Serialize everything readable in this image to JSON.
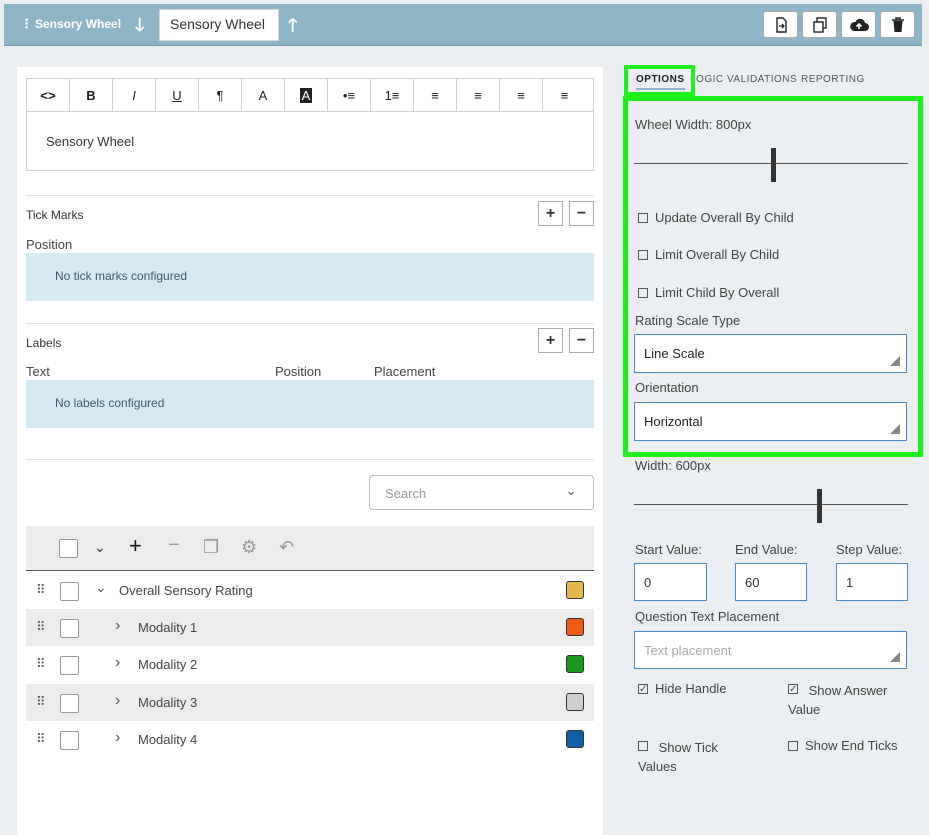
{
  "header": {
    "menu_glyph": "⋮",
    "app_title": "Sensory Wheel",
    "question_title": "Sensory Wheel",
    "down_glyph": "🡓",
    "up_glyph": "🡑"
  },
  "editor": {
    "toolbar": [
      {
        "name": "code-view-button",
        "glyph": "<>"
      },
      {
        "name": "bold-button",
        "glyph": "B"
      },
      {
        "name": "italic-button",
        "glyph": "I"
      },
      {
        "name": "underline-button",
        "glyph": "U"
      },
      {
        "name": "paragraph-button",
        "glyph": "¶"
      },
      {
        "name": "font-color-button",
        "glyph": "A"
      },
      {
        "name": "bg-color-button",
        "glyph": "A"
      },
      {
        "name": "bullet-list-button",
        "glyph": "•≡"
      },
      {
        "name": "numbered-list-button",
        "glyph": "1≡"
      },
      {
        "name": "align-left-button",
        "glyph": "≡"
      },
      {
        "name": "align-center-button",
        "glyph": "≡"
      },
      {
        "name": "align-right-button",
        "glyph": "≡"
      },
      {
        "name": "justify-button",
        "glyph": "≡"
      }
    ],
    "content": "Sensory Wheel"
  },
  "tick_marks": {
    "title": "Tick Marks",
    "position_label": "Position",
    "empty_text": "No tick marks configured",
    "add_glyph": "+",
    "remove_glyph": "−"
  },
  "labels": {
    "title": "Labels",
    "col_text": "Text",
    "col_position": "Position",
    "col_placement": "Placement",
    "empty_text": "No labels configured",
    "add_glyph": "+",
    "remove_glyph": "−"
  },
  "search": {
    "placeholder": "Search",
    "chevron": "⌄"
  },
  "tree": {
    "toolbar": {
      "dropdown": "⌄",
      "add": "+",
      "remove": "−",
      "copy": "❐",
      "settings": "⚙",
      "undo": "↶"
    },
    "rows": [
      {
        "label": "Overall Sensory Rating",
        "expander": "⌄",
        "color": "#e8b84a"
      },
      {
        "label": "Modality 1",
        "expander": "›",
        "color": "#f05a14"
      },
      {
        "label": "Modality 2",
        "expander": "›",
        "color": "#1e9a22"
      },
      {
        "label": "Modality 3",
        "expander": "›",
        "color": "#cfcfcf"
      },
      {
        "label": "Modality 4",
        "expander": "›",
        "color": "#1060a8"
      }
    ],
    "drag_glyph": "⠿"
  },
  "options": {
    "tabs": [
      "OPTIONS",
      "LOGIC",
      "VALIDATIONS",
      "REPORTING"
    ],
    "wheel_width_label": "Wheel Width: 800px",
    "wheel_width_value": 800,
    "checks": [
      {
        "label": "Update Overall By Child",
        "checked": false
      },
      {
        "label": "Limit Overall By Child",
        "checked": false
      },
      {
        "label": "Limit Child By Overall",
        "checked": false
      }
    ],
    "rating_scale_label": "Rating Scale Type",
    "rating_scale_value": "Line Scale",
    "orientation_label": "Orientation",
    "orientation_value": "Horizontal",
    "width_label": "Width: 600px",
    "width_value": 600,
    "start_label": "Start Value:",
    "start_value": "0",
    "end_label": "End Value:",
    "end_value": "60",
    "step_label": "Step Value:",
    "step_value": "1",
    "qtp_label": "Question Text Placement",
    "qtp_placeholder": "Text placement",
    "hide_handle_label": "Hide Handle",
    "hide_handle_checked": true,
    "show_answer_label": "Show Answer Value",
    "show_answer_checked": true,
    "show_tick_values_label": "Show Tick Values",
    "show_tick_values_checked": false,
    "show_end_ticks_label": "Show End Ticks",
    "show_end_ticks_checked": false
  },
  "colors": {
    "header_bg": "#8db7c9",
    "highlight": "#1ef01e",
    "info_bg": "#d7e9f3",
    "focus_border": "#4a88c8"
  }
}
